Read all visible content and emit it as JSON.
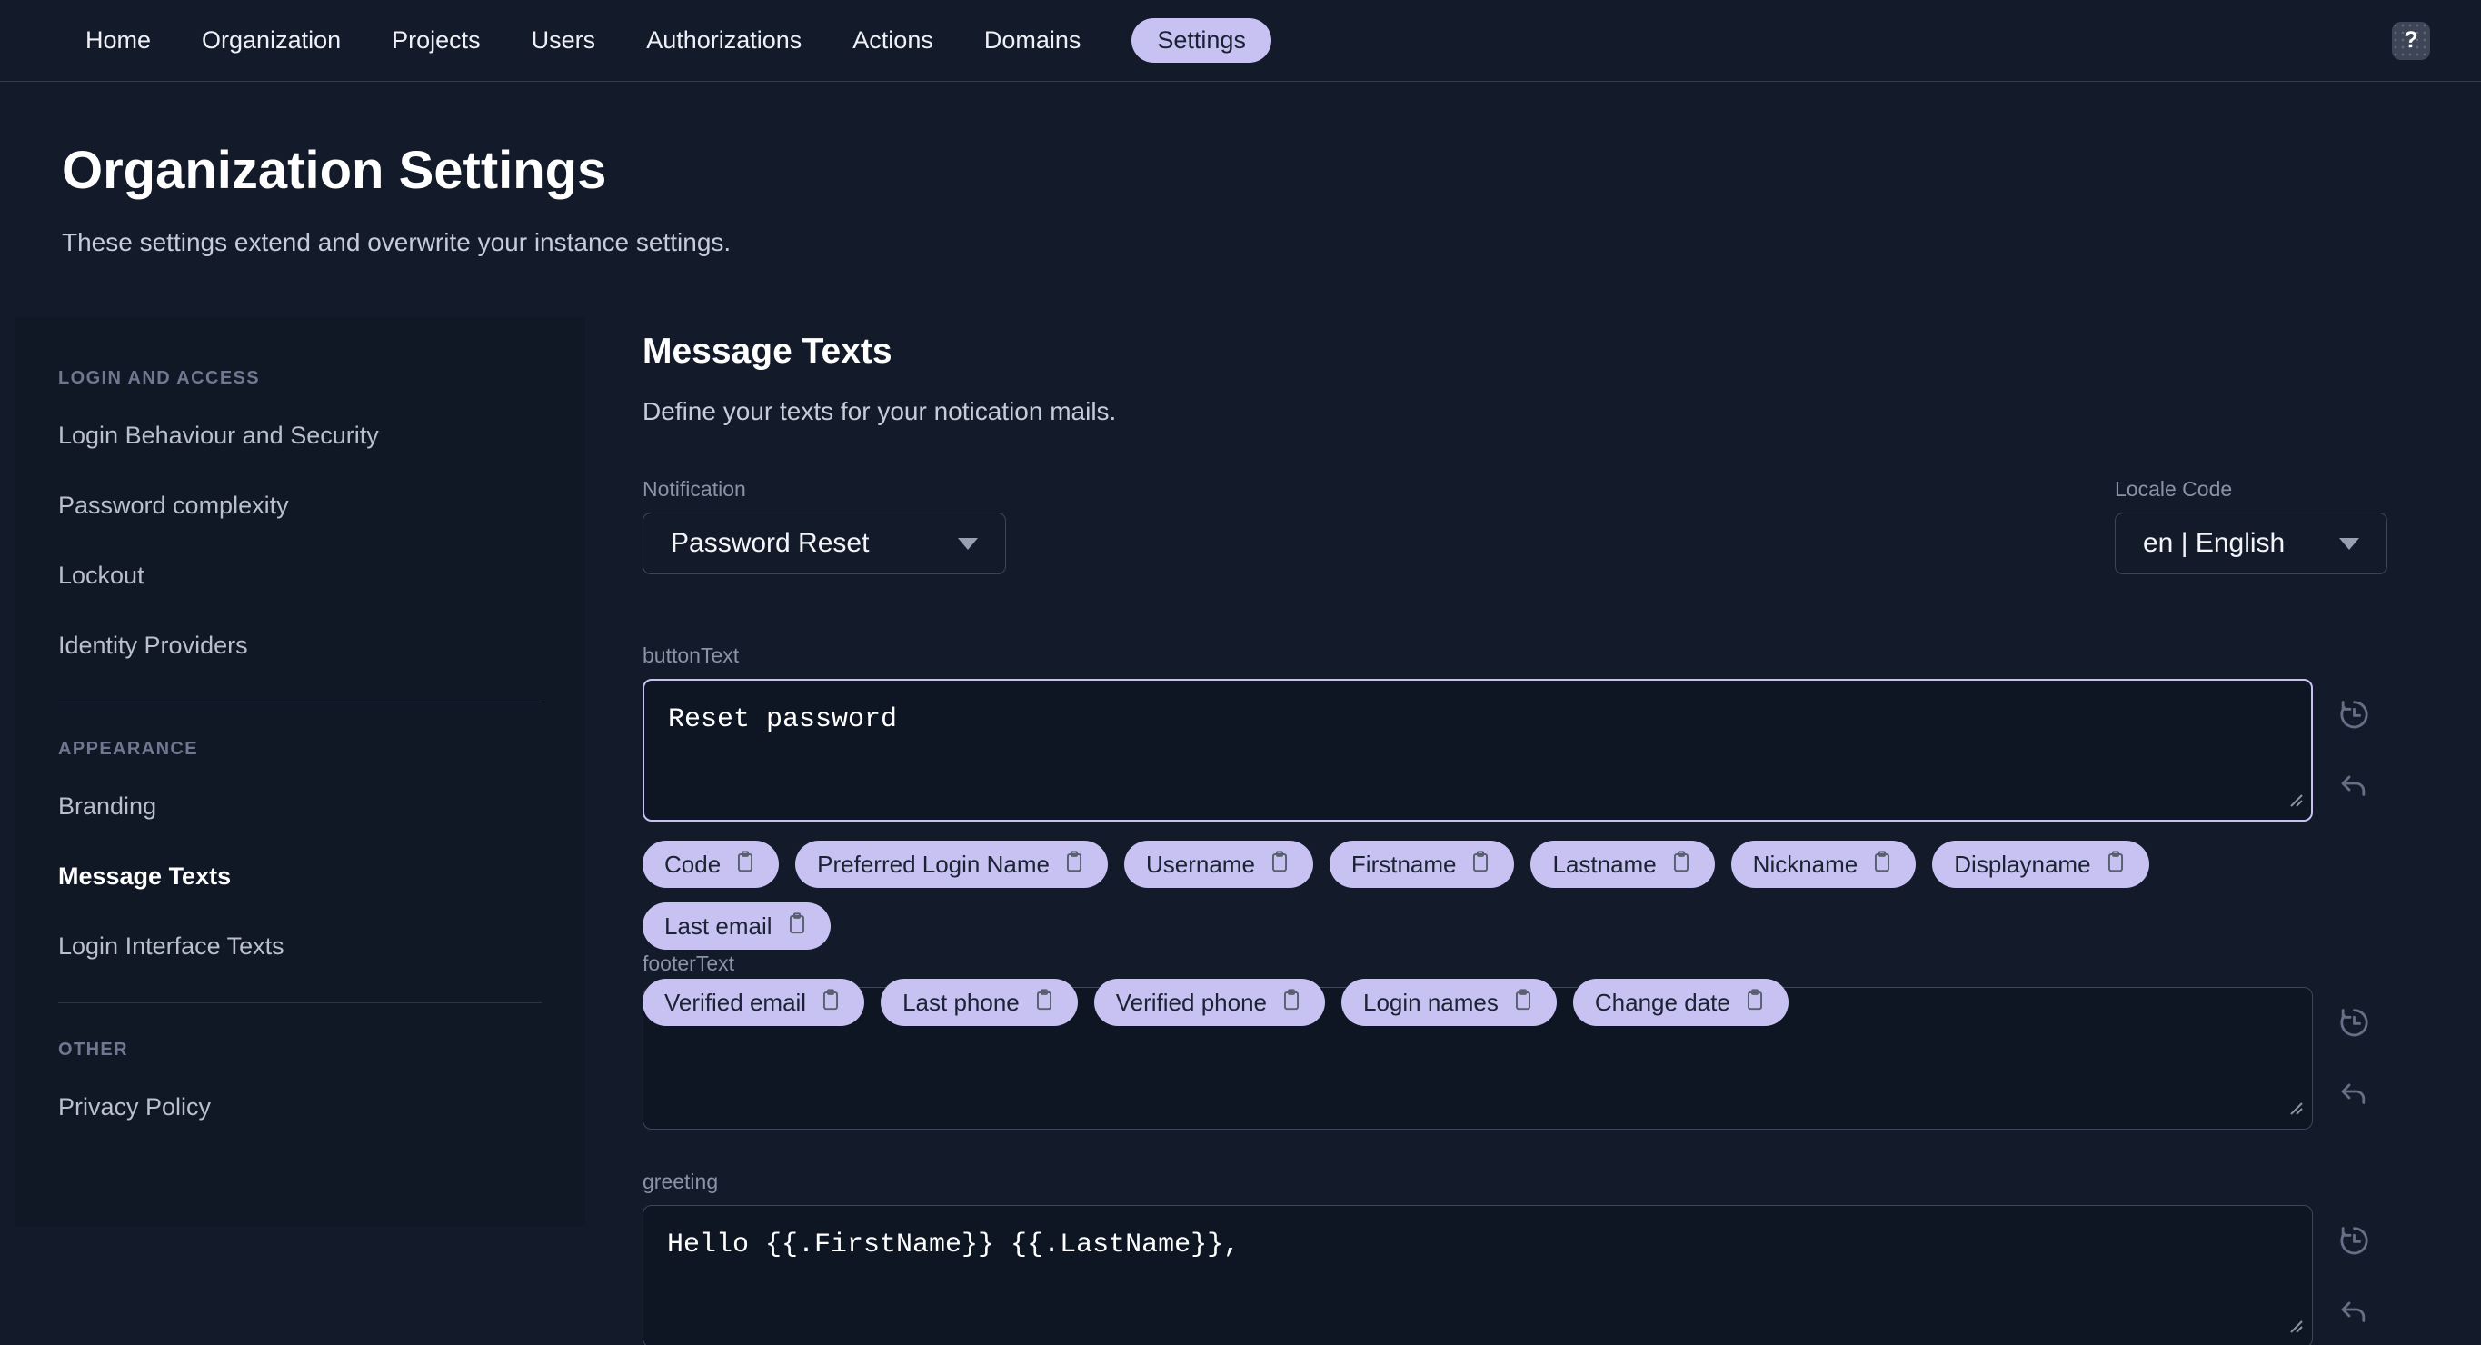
{
  "colors": {
    "accent": "#c8c2f2",
    "background": "#131b2b",
    "sidebar_bg": "#101826"
  },
  "nav": {
    "items": [
      {
        "label": "Home"
      },
      {
        "label": "Organization"
      },
      {
        "label": "Projects"
      },
      {
        "label": "Users"
      },
      {
        "label": "Authorizations"
      },
      {
        "label": "Actions"
      },
      {
        "label": "Domains"
      },
      {
        "label": "Settings"
      }
    ],
    "active": "Settings",
    "help_label": "?"
  },
  "hero": {
    "title": "Organization Settings",
    "subtitle": "These settings extend and overwrite your instance settings."
  },
  "sidebar": {
    "sections": [
      {
        "title": "LOGIN AND ACCESS",
        "items": [
          "Login Behaviour and Security",
          "Password complexity",
          "Lockout",
          "Identity Providers"
        ]
      },
      {
        "title": "APPEARANCE",
        "items": [
          "Branding",
          "Message Texts",
          "Login Interface Texts"
        ]
      },
      {
        "title": "OTHER",
        "items": [
          "Privacy Policy"
        ]
      }
    ],
    "active_item": "Message Texts"
  },
  "main": {
    "heading": "Message Texts",
    "description": "Define your texts for your notication mails.",
    "notification": {
      "label": "Notification",
      "value": "Password Reset"
    },
    "locale": {
      "label": "Locale Code",
      "value": "en | English"
    },
    "fields": [
      {
        "label": "buttonText",
        "value": "Reset password"
      },
      {
        "label": "footerText",
        "value": ""
      },
      {
        "label": "greeting",
        "value": "Hello {{.FirstName}} {{.LastName}},"
      }
    ],
    "chips": [
      "Code",
      "Preferred Login Name",
      "Username",
      "Firstname",
      "Lastname",
      "Nickname",
      "Displayname",
      "Last email",
      "Verified email",
      "Last phone",
      "Verified phone",
      "Login names",
      "Change date"
    ]
  }
}
